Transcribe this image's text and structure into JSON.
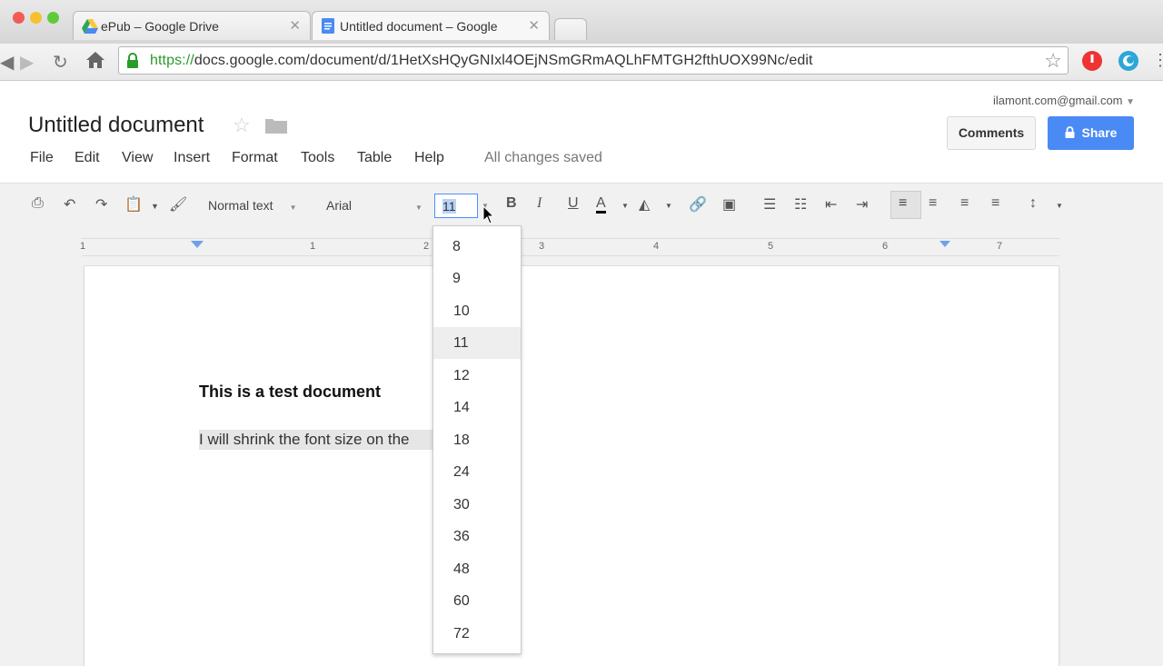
{
  "browser": {
    "tabs": [
      {
        "label": "ePub – Google Drive",
        "active": false
      },
      {
        "label": "Untitled document – Google",
        "active": true
      }
    ],
    "url_scheme": "https://",
    "url_rest": "docs.google.com/document/d/1HetXsHQyGNIxl4OEjNSmGRmAQLhFMTGH2fthUOX99Nc/edit"
  },
  "header": {
    "title": "Untitled document",
    "account": "ilamont.com@gmail.com",
    "comments": "Comments",
    "share": "Share",
    "save_status": "All changes saved"
  },
  "menu": [
    "File",
    "Edit",
    "View",
    "Insert",
    "Format",
    "Tools",
    "Table",
    "Help"
  ],
  "toolbar": {
    "style": "Normal text",
    "font": "Arial",
    "size": "11"
  },
  "ruler": [
    "1",
    "1",
    "2",
    "3",
    "4",
    "5",
    "6",
    "7"
  ],
  "document": {
    "heading": "This is a test document",
    "body": "I will shrink the font size on the"
  },
  "size_menu": {
    "options": [
      "8",
      "9",
      "10",
      "11",
      "12",
      "14",
      "18",
      "24",
      "30",
      "36",
      "48",
      "60",
      "72"
    ],
    "selected": "11"
  },
  "colors": {
    "accent": "#4a8af4",
    "select_border": "#4d90fe"
  }
}
